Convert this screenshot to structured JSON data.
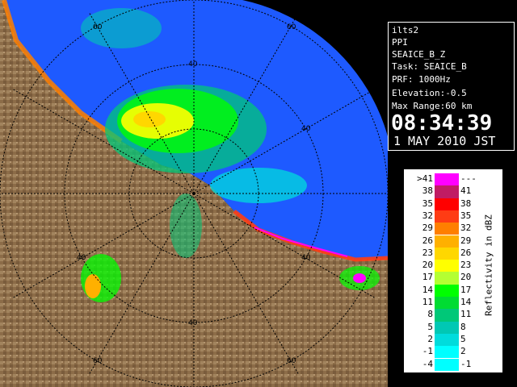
{
  "info": {
    "site": "ilts2",
    "product": "PPI",
    "field": "SEAICE_B_Z",
    "task": "Task: SEAICE_B",
    "prf": "PRF: 1000Hz",
    "elevation": "Elevation:-0.5",
    "max_range": "Max Range:60 km",
    "time": "08:34:39",
    "date": "1 MAY 2010 JST"
  },
  "scale": {
    "unit_label": "Reflectivity in dBZ",
    "rows": [
      {
        "left": ">41",
        "right": "---",
        "color": "#ff00ff"
      },
      {
        "left": "38",
        "right": "41",
        "color": "#c01c64"
      },
      {
        "left": "35",
        "right": "38",
        "color": "#ff0000"
      },
      {
        "left": "32",
        "right": "35",
        "color": "#ff3c14"
      },
      {
        "left": "29",
        "right": "32",
        "color": "#ff7f00"
      },
      {
        "left": "26",
        "right": "29",
        "color": "#ffb000"
      },
      {
        "left": "23",
        "right": "26",
        "color": "#ffd700"
      },
      {
        "left": "20",
        "right": "23",
        "color": "#ffff00"
      },
      {
        "left": "17",
        "right": "20",
        "color": "#b4ff32"
      },
      {
        "left": "14",
        "right": "17",
        "color": "#00ff00"
      },
      {
        "left": "11",
        "right": "14",
        "color": "#00dc32"
      },
      {
        "left": "8",
        "right": "11",
        "color": "#00c878"
      },
      {
        "left": "5",
        "right": "8",
        "color": "#00c8b4"
      },
      {
        "left": "2",
        "right": "5",
        "color": "#00dcdc"
      },
      {
        "left": "-1",
        "right": "2",
        "color": "#00ffff"
      },
      {
        "left": "-4",
        "right": "-1",
        "color": "#00ffff"
      }
    ]
  },
  "radar": {
    "range_rings": [
      "20",
      "40",
      "60"
    ],
    "ring_labels": [
      "60",
      "60",
      "40",
      "40",
      "40",
      "40",
      "40",
      "60",
      "60"
    ],
    "colors": {
      "sea": "#1e5aff",
      "land": "#9b7a55",
      "ring": "#000000"
    }
  }
}
